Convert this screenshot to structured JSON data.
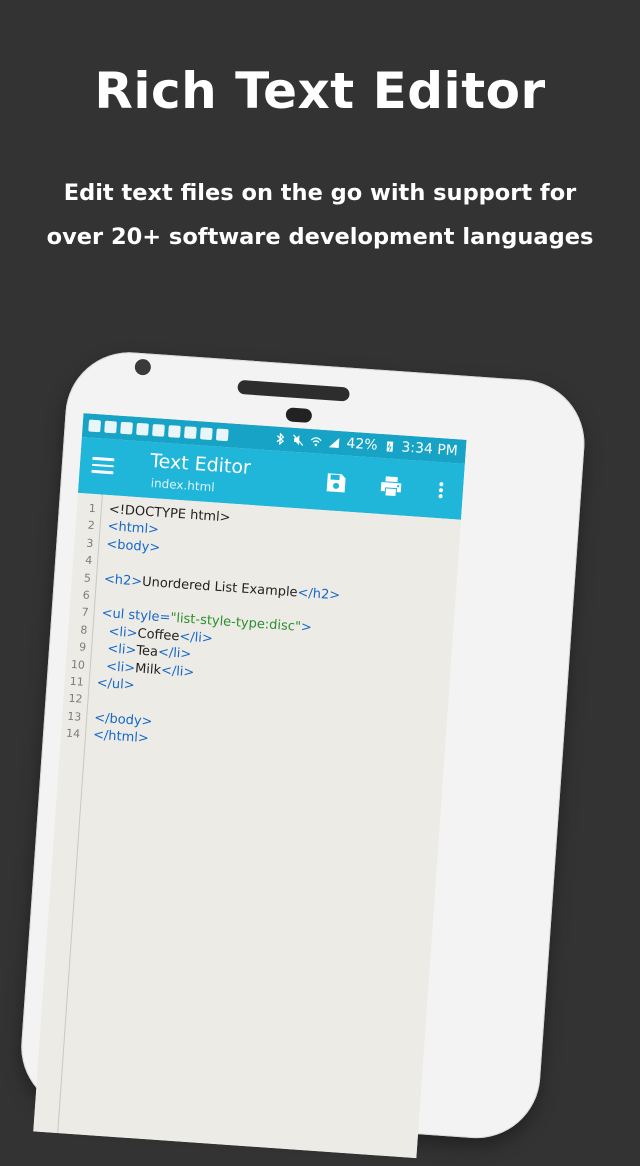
{
  "promo": {
    "title": "Rich Text Editor",
    "subtitle_line1": "Edit text files on the go with support for",
    "subtitle_line2": "over 20+ software development languages"
  },
  "statusbar": {
    "battery": "42%",
    "time": "3:34 PM"
  },
  "toolbar": {
    "title": "Text Editor",
    "filename": "index.html"
  },
  "icons": {
    "menu": "hamburger-menu-icon",
    "save": "save-icon",
    "print": "print-icon",
    "more": "more-vert-icon"
  },
  "editor": {
    "lines": [
      {
        "n": "1",
        "parts": [
          {
            "t": "<!DOCTYPE html>",
            "c": "txt"
          }
        ]
      },
      {
        "n": "2",
        "parts": [
          {
            "t": "<html>",
            "c": "tag"
          }
        ]
      },
      {
        "n": "3",
        "parts": [
          {
            "t": "<body>",
            "c": "tag"
          }
        ]
      },
      {
        "n": "4",
        "parts": []
      },
      {
        "n": "5",
        "parts": [
          {
            "t": "<h2>",
            "c": "tag"
          },
          {
            "t": "Unordered List Example",
            "c": "txt"
          },
          {
            "t": "</h2>",
            "c": "tag"
          }
        ]
      },
      {
        "n": "6",
        "parts": []
      },
      {
        "n": "7",
        "parts": [
          {
            "t": "<ul ",
            "c": "tag"
          },
          {
            "t": "style=",
            "c": "attr"
          },
          {
            "t": "\"list-style-type:disc\"",
            "c": "str"
          },
          {
            "t": ">",
            "c": "tag"
          }
        ]
      },
      {
        "n": "8",
        "parts": [
          {
            "t": "  <li>",
            "c": "tag"
          },
          {
            "t": "Coffee",
            "c": "txt"
          },
          {
            "t": "</li>",
            "c": "tag"
          }
        ]
      },
      {
        "n": "9",
        "parts": [
          {
            "t": "  <li>",
            "c": "tag"
          },
          {
            "t": "Tea",
            "c": "txt"
          },
          {
            "t": "</li>",
            "c": "tag"
          }
        ]
      },
      {
        "n": "10",
        "parts": [
          {
            "t": "  <li>",
            "c": "tag"
          },
          {
            "t": "Milk",
            "c": "txt"
          },
          {
            "t": "</li>",
            "c": "tag"
          }
        ]
      },
      {
        "n": "11",
        "parts": [
          {
            "t": "</ul>",
            "c": "tag"
          }
        ]
      },
      {
        "n": "12",
        "parts": []
      },
      {
        "n": "13",
        "parts": [
          {
            "t": "</body>",
            "c": "tag"
          }
        ]
      },
      {
        "n": "14",
        "parts": [
          {
            "t": "</html>",
            "c": "tag"
          }
        ]
      }
    ]
  },
  "colors": {
    "background": "#333333",
    "toolbar": "#1fb6d9",
    "statusbar": "#16a3c6",
    "editor_bg": "#ecebe6",
    "tag": "#1668c9",
    "string": "#2d8f2d"
  }
}
